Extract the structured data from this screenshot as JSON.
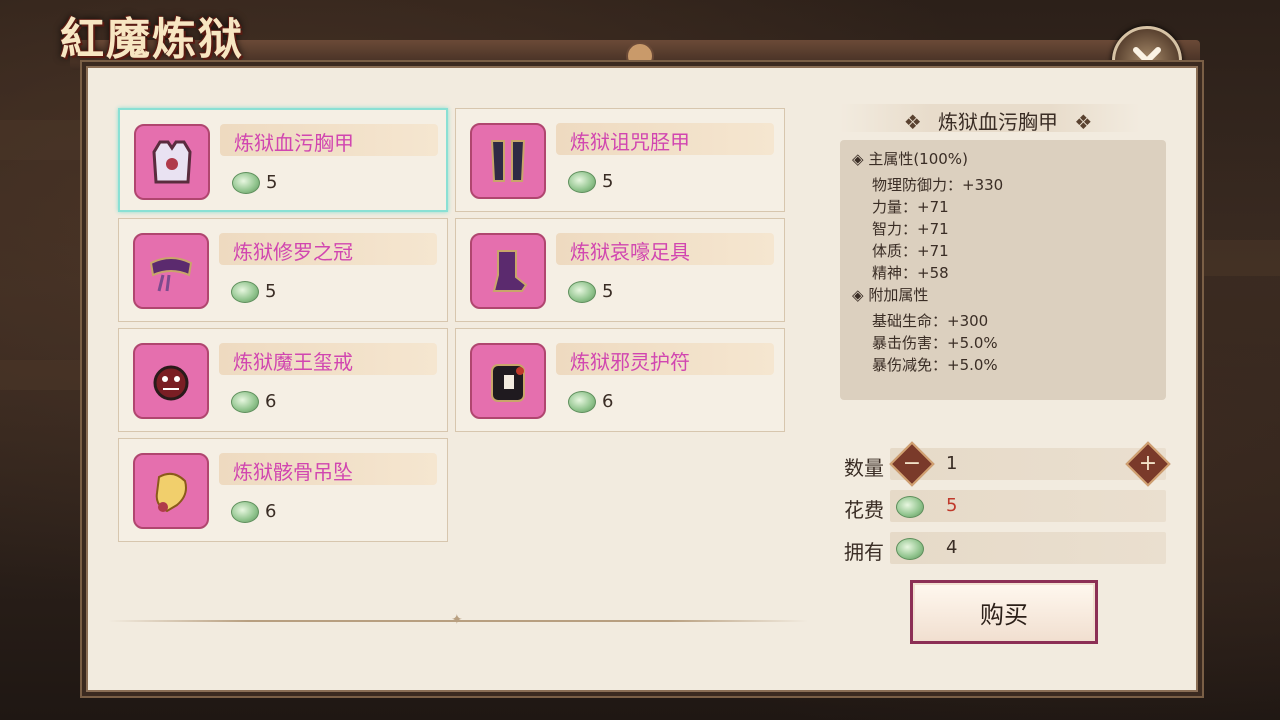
{
  "game_title": "紅魔炼狱",
  "colors": {
    "panel_bg": "#f2ebdf",
    "item_name": "#d146b0",
    "cost_value": "#c0392b",
    "selected_border": "#8ae0d4"
  },
  "items": [
    {
      "name": "炼狱血污胸甲",
      "price": "5",
      "icon": "chest-armor-icon",
      "selected": true
    },
    {
      "name": "炼狱诅咒胫甲",
      "price": "5",
      "icon": "greaves-icon"
    },
    {
      "name": "炼狱修罗之冠",
      "price": "5",
      "icon": "crown-icon"
    },
    {
      "name": "炼狱哀嚎足具",
      "price": "5",
      "icon": "boots-icon"
    },
    {
      "name": "炼狱魔王玺戒",
      "price": "6",
      "icon": "demon-ring-icon"
    },
    {
      "name": "炼狱邪灵护符",
      "price": "6",
      "icon": "amulet-icon"
    },
    {
      "name": "炼狱骸骨吊坠",
      "price": "6",
      "icon": "skull-pendant-icon"
    }
  ],
  "detail": {
    "title": "炼狱血污胸甲",
    "main_attr_header": "主属性(100%)",
    "main_attrs": [
      "物理防御力：+330",
      "力量：+71",
      "智力：+71",
      "体质：+71",
      "精神：+58"
    ],
    "extra_attr_header": "附加属性",
    "extra_attrs": [
      "基础生命：+300",
      "暴击伤害：+5.0%",
      "暴伤减免：+5.0%"
    ]
  },
  "purchase": {
    "quantity_label": "数量",
    "quantity": "1",
    "cost_label": "花费",
    "cost": "5",
    "owned_label": "拥有",
    "owned": "4",
    "buy_label": "购买"
  }
}
